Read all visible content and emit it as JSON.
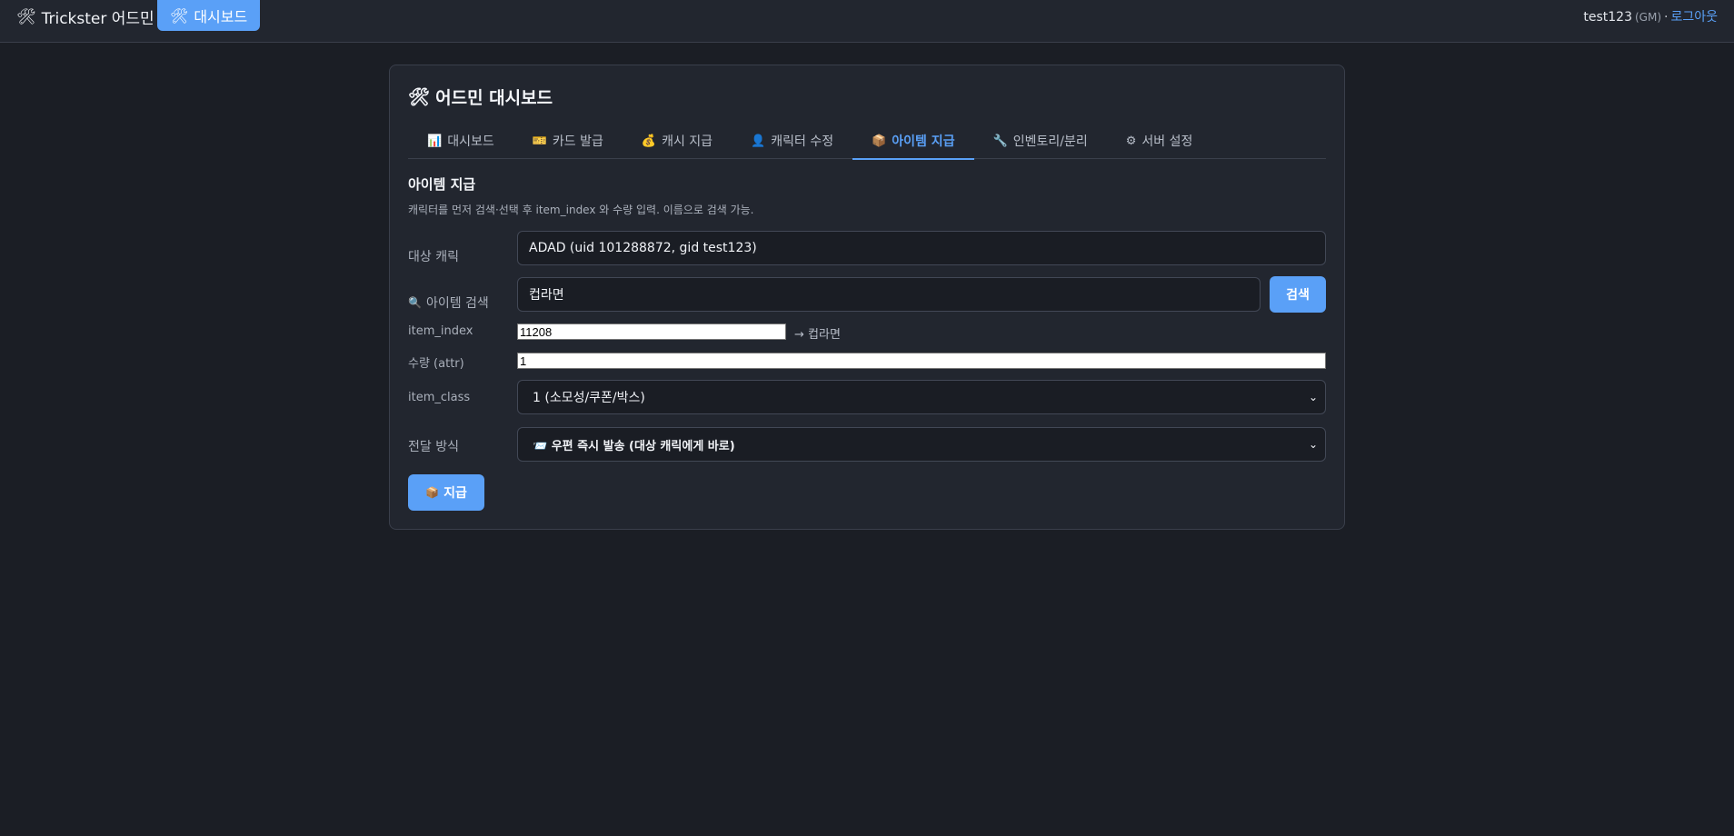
{
  "topbar": {
    "brand": "Trickster 어드민",
    "brand_icon": "tools-icon",
    "nav_button": "대시보드",
    "user": "test123",
    "role": "(GM)",
    "separator": "·",
    "logout": "로그아웃"
  },
  "panel": {
    "title": "어드민 대시보드",
    "tabs": [
      {
        "label": "대시보드",
        "icon": "📊",
        "icon_name": "bar-chart-icon"
      },
      {
        "label": "카드 발급",
        "icon": "🎫",
        "icon_name": "ticket-icon"
      },
      {
        "label": "캐시 지급",
        "icon": "💰",
        "icon_name": "money-bag-icon"
      },
      {
        "label": "캐릭터 수정",
        "icon": "👤",
        "icon_name": "user-icon"
      },
      {
        "label": "아이템 지급",
        "icon": "📦",
        "icon_name": "package-icon"
      },
      {
        "label": "인벤토리/분리",
        "icon": "🔧",
        "icon_name": "wrench-icon"
      },
      {
        "label": "서버 설정",
        "icon": "⚙",
        "icon_name": "gear-icon"
      }
    ],
    "active_tab": 4,
    "section_title": "아이템 지급",
    "hint": "캐릭터를 먼저 검색·선택 후 item_index 와 수량 입력. 이름으로 검색 가능.",
    "target_label": "대상 캐릭",
    "target_value": "ADAD (uid 101288872, gid test123)",
    "search_label": "아이템 검색",
    "search_value": "컵라면",
    "search_button": "검색",
    "item_index_label": "item_index",
    "item_index_value": "11208",
    "item_index_note": "→ 컵라면",
    "qty_label": "수량 (attr)",
    "qty_value": "1",
    "class_label": "item_class",
    "class_value": "1 (소모성/쿠폰/박스)",
    "delivery_label": "전달 방식",
    "delivery_value": "📨 우편 즉시 발송 (대상 캐릭에게 바로)",
    "submit_label": "지급"
  },
  "colors": {
    "accent": "#5aa0f7",
    "background": "#1b1e25",
    "panel": "#22262f"
  }
}
